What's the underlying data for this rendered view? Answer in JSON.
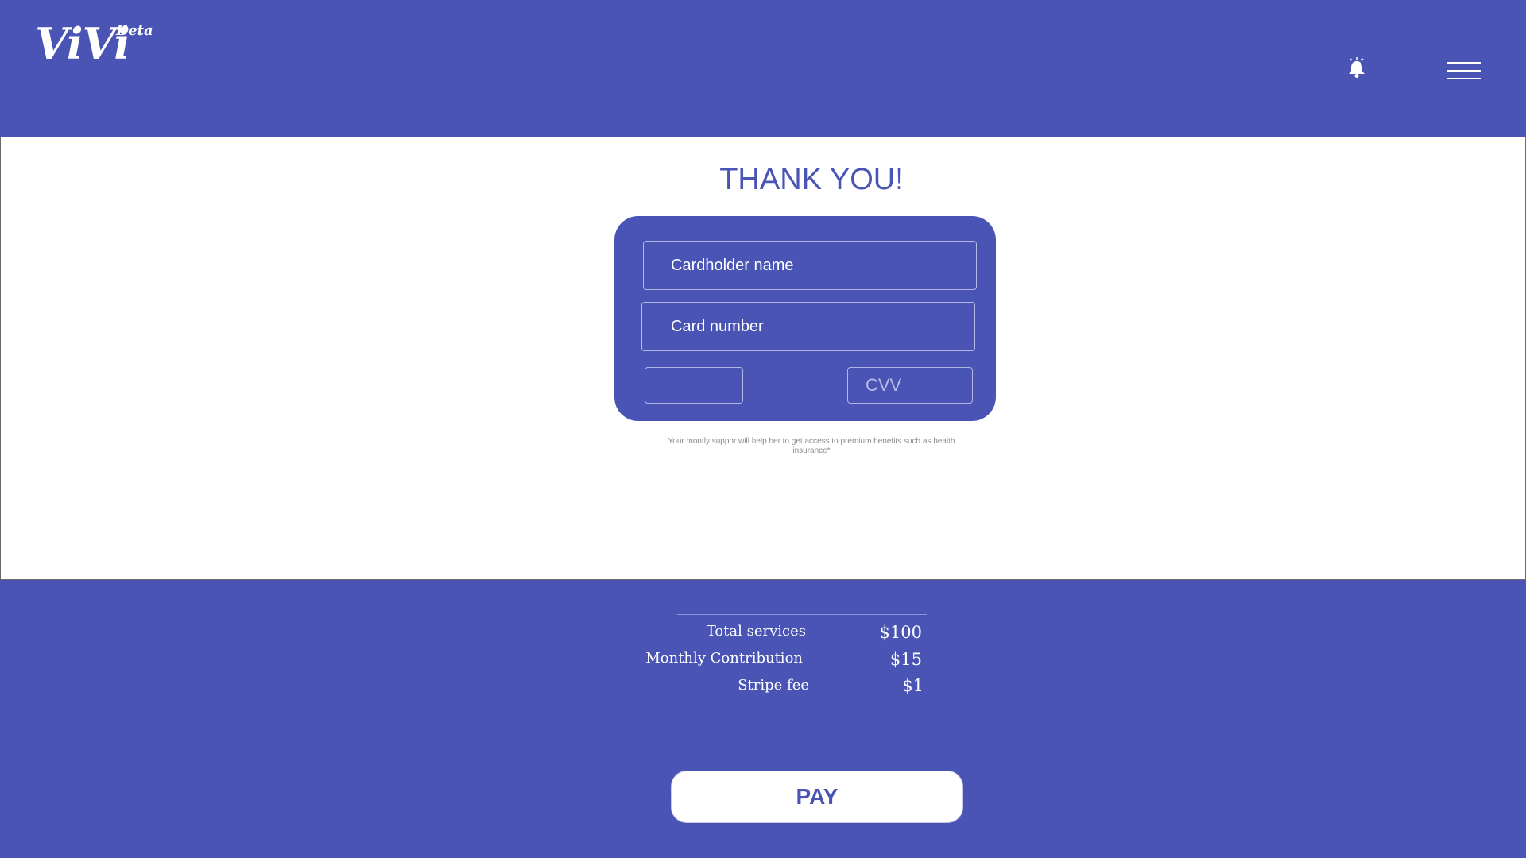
{
  "header": {
    "logo": "ViVi",
    "logo_badge": "Beta",
    "bell_icon": "bell-icon",
    "menu_icon": "hamburger-menu-icon"
  },
  "main": {
    "title": "THANK YOU!",
    "card_form": {
      "cardholder_placeholder": "Cardholder name",
      "card_number_placeholder": "Card number",
      "expiry_value": "",
      "cvv_placeholder": "CVV"
    },
    "note": "Your montly suppor will help her to get  access to premium benefits such as health insurance*"
  },
  "summary": {
    "rows": [
      {
        "label": "Total services",
        "value": "$100"
      },
      {
        "label": "Monthly Contribution",
        "value": "$15"
      },
      {
        "label": "Stripe fee",
        "value": "$1"
      }
    ]
  },
  "actions": {
    "pay_label": "PAY"
  },
  "colors": {
    "primary": "#4954B5",
    "panel": "#ffffff",
    "note_text": "#8a8a8a"
  }
}
